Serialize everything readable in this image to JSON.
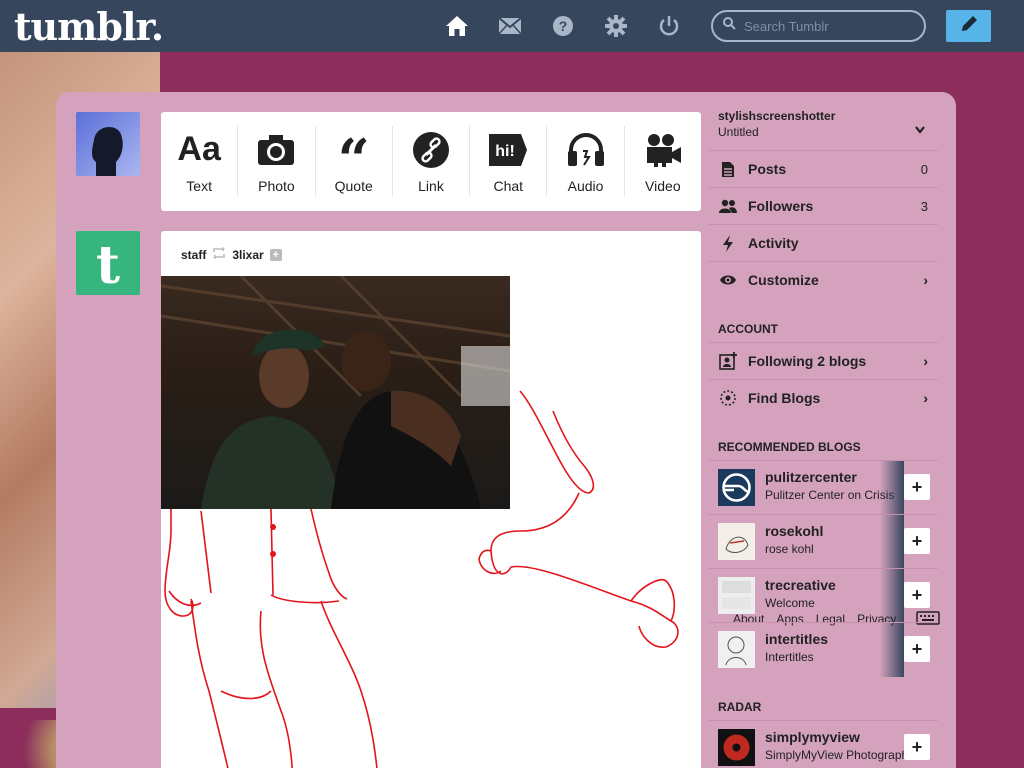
{
  "header": {
    "logo": "tumblr.",
    "search_placeholder": "Search Tumblr",
    "nav_icons": [
      "home-icon",
      "mail-icon",
      "help-icon",
      "gear-icon",
      "power-icon"
    ],
    "compose_icon": "pencil-icon"
  },
  "post_types": [
    {
      "label": "Text",
      "icon": "text-aa-icon"
    },
    {
      "label": "Photo",
      "icon": "camera-icon"
    },
    {
      "label": "Quote",
      "icon": "quote-icon"
    },
    {
      "label": "Link",
      "icon": "link-icon"
    },
    {
      "label": "Chat",
      "icon": "chat-icon"
    },
    {
      "label": "Audio",
      "icon": "headphones-icon"
    },
    {
      "label": "Video",
      "icon": "video-camera-icon"
    }
  ],
  "post": {
    "author": "staff",
    "reblogged_from": "3lixar",
    "reblog_icon": "reblog-icon"
  },
  "sidebar": {
    "blog_name": "stylishscreenshotter",
    "blog_title": "Untitled",
    "rows": [
      {
        "label": "Posts",
        "count": "0",
        "icon": "posts-icon"
      },
      {
        "label": "Followers",
        "count": "3",
        "icon": "followers-icon"
      },
      {
        "label": "Activity",
        "icon": "lightning-icon"
      },
      {
        "label": "Customize",
        "icon": "eye-icon",
        "chevron": "›"
      }
    ],
    "account_title": "ACCOUNT",
    "account_rows": [
      {
        "label": "Following 2 blogs",
        "icon": "following-icon",
        "chevron": "›"
      },
      {
        "label": "Find Blogs",
        "icon": "find-blogs-icon",
        "chevron": "›"
      }
    ],
    "recommended_title": "RECOMMENDED BLOGS",
    "recommended": [
      {
        "name": "pulitzercenter",
        "desc": "Pulitzer Center on Crisis",
        "color": "#1b3b5e"
      },
      {
        "name": "rosekohl",
        "desc": "rose kohl",
        "color": "#f3efe8"
      },
      {
        "name": "trecreative",
        "desc": "Welcome",
        "color": "#eeeeee"
      },
      {
        "name": "intertitles",
        "desc": "Intertitles",
        "color": "#f0f0f0"
      }
    ],
    "footer_links": [
      "About",
      "Apps",
      "Legal",
      "Privacy"
    ],
    "radar_title": "RADAR",
    "radar": {
      "name": "simplymyview",
      "desc": "SimplyMyView Photography",
      "color": "#c0291f"
    }
  }
}
